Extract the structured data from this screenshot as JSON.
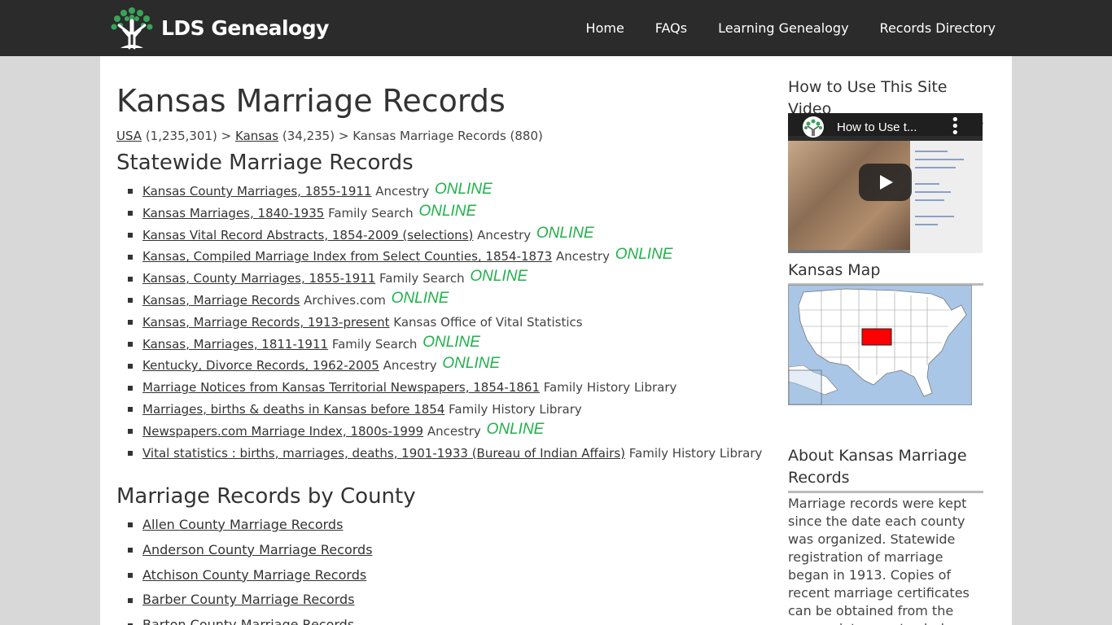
{
  "header": {
    "logo_text": "LDS Genealogy",
    "nav": [
      {
        "label": "Home"
      },
      {
        "label": "FAQs"
      },
      {
        "label": "Learning Genealogy"
      },
      {
        "label": "Records Directory"
      }
    ]
  },
  "main": {
    "title": "Kansas Marriage Records",
    "breadcrumb": {
      "usa_link": "USA",
      "usa_count": "(1,235,301) >",
      "kansas_link": "Kansas",
      "kansas_count": "(34,235) >",
      "current": "Kansas Marriage Records (880)"
    },
    "statewide_heading": "Statewide Marriage Records",
    "statewide_items": [
      {
        "link": "Kansas County Marriages, 1855-1911",
        "source": "Ancestry",
        "badge": "ONLINE"
      },
      {
        "link": "Kansas Marriages, 1840-1935",
        "source": "Family Search",
        "badge": "ONLINE"
      },
      {
        "link": "Kansas Vital Record Abstracts, 1854-2009 (selections)",
        "source": "Ancestry",
        "badge": "ONLINE"
      },
      {
        "link": "Kansas, Compiled Marriage Index from Select Counties, 1854-1873",
        "source": "Ancestry",
        "badge": "ONLINE"
      },
      {
        "link": "Kansas, County Marriages, 1855-1911",
        "source": "Family Search",
        "badge": "ONLINE"
      },
      {
        "link": "Kansas, Marriage Records",
        "source": "Archives.com",
        "badge": "ONLINE"
      },
      {
        "link": "Kansas, Marriage Records, 1913-present",
        "source": "Kansas Office of Vital Statistics",
        "badge": ""
      },
      {
        "link": "Kansas, Marriages, 1811-1911",
        "source": "Family Search",
        "badge": "ONLINE"
      },
      {
        "link": "Kentucky, Divorce Records, 1962-2005",
        "source": "Ancestry",
        "badge": "ONLINE"
      },
      {
        "link": "Marriage Notices from Kansas Territorial Newspapers, 1854-1861",
        "source": "Family History Library",
        "badge": ""
      },
      {
        "link": "Marriages, births & deaths in Kansas before 1854",
        "source": "Family History Library",
        "badge": ""
      },
      {
        "link": "Newspapers.com Marriage Index, 1800s-1999",
        "source": "Ancestry",
        "badge": "ONLINE"
      },
      {
        "link": "Vital statistics : births, marriages, deaths, 1901-1933 (Bureau of Indian Affairs)",
        "source": "Family History Library",
        "badge": ""
      }
    ],
    "county_heading": "Marriage Records by County",
    "county_items": [
      {
        "link": "Allen County Marriage Records"
      },
      {
        "link": "Anderson County Marriage Records"
      },
      {
        "link": "Atchison County Marriage Records"
      },
      {
        "link": "Barber County Marriage Records"
      },
      {
        "link": "Barton County Marriage Records"
      }
    ]
  },
  "sidebar": {
    "video_heading": "How to Use This Site Video",
    "video_title": "How to Use t...",
    "map_heading": "Kansas Map",
    "about_heading": "About Kansas Marriage Records",
    "about_text": "Marriage records were kept since the date each county was organized. Statewide registration of marriage began in 1913. Copies of recent marriage certificates can be obtained from the appropriate county clerk or the Kansas"
  },
  "colors": {
    "header_bg": "#2b2b2b",
    "online_badge": "#22b14c",
    "kansas_highlight": "#ff0000"
  }
}
